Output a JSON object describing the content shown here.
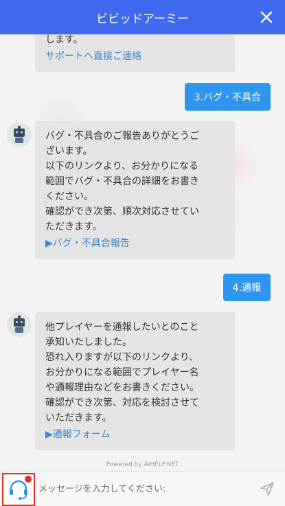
{
  "header": {
    "title": "ビビッドアーミー"
  },
  "messages": {
    "first_tail": [
      "します。"
    ],
    "first_link": "サポートへ直接ご連絡",
    "user1": "3.バグ・不具合",
    "bot1": {
      "lines": [
        "バグ・不具合のご報告ありがとうご",
        "ざいます。",
        "以下のリンクより、お分かりになる",
        "範囲でバグ・不具合の詳細をお書き",
        "ください。",
        "確認ができ次第、順次対応させてい",
        "ただきます。"
      ],
      "link": "▶バグ・不具合報告"
    },
    "user2": "4.通報",
    "bot2": {
      "lines": [
        "他プレイヤーを通報したいとのこと",
        "承知いたしました。",
        "恐れ入りますが以下のリンクより、",
        "お分かりになる範囲でプレイヤー名",
        "や通報理由などをお書きください。",
        "確認ができ次第、対応を検討させて",
        "いただきます。"
      ],
      "link": "▶通報フォーム"
    }
  },
  "footer": {
    "powered": "Powered by AIHELP.NET"
  },
  "input": {
    "placeholder": "メッセージを入力してください:",
    "value": ""
  },
  "colors": {
    "header": "#3f6af0",
    "user_bubble": "#2f96ef",
    "link": "#3a83d0",
    "badge": "#e0302c"
  },
  "icons": {
    "close": "close-icon",
    "support": "headset-icon",
    "send": "send-icon",
    "avatar": "robot-avatar-icon"
  }
}
